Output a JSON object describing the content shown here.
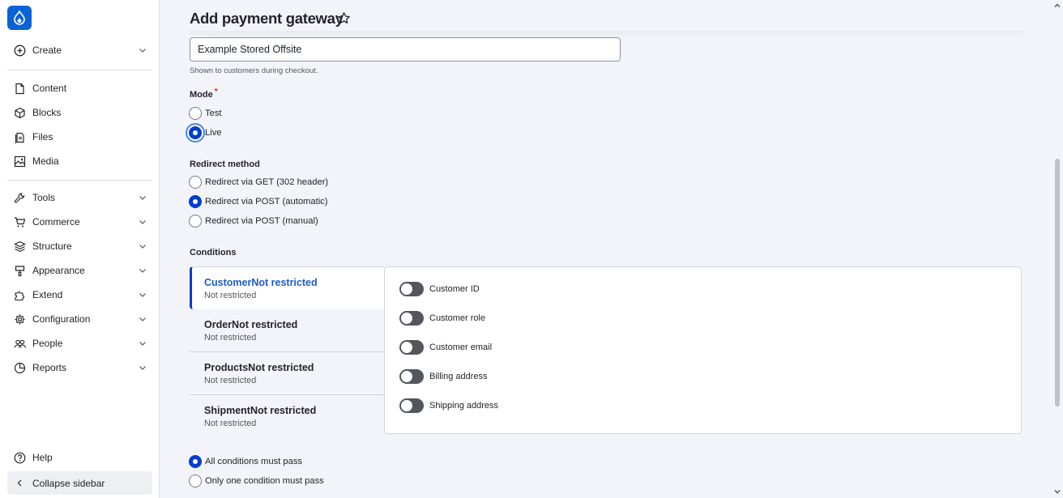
{
  "sidebar": {
    "logo": "drupal-drop-icon",
    "items": [
      {
        "label": "Create",
        "icon": "plus-circle-icon",
        "has_chevron": true
      },
      {
        "label": "Content",
        "icon": "document-icon",
        "has_chevron": false
      },
      {
        "label": "Blocks",
        "icon": "cube-icon",
        "has_chevron": false
      },
      {
        "label": "Files",
        "icon": "files-icon",
        "has_chevron": false
      },
      {
        "label": "Media",
        "icon": "image-icon",
        "has_chevron": false
      },
      {
        "label": "Tools",
        "icon": "wrench-icon",
        "has_chevron": true
      },
      {
        "label": "Commerce",
        "icon": "cart-icon",
        "has_chevron": true
      },
      {
        "label": "Structure",
        "icon": "layers-icon",
        "has_chevron": true
      },
      {
        "label": "Appearance",
        "icon": "paint-roller-icon",
        "has_chevron": true
      },
      {
        "label": "Extend",
        "icon": "puzzle-icon",
        "has_chevron": true
      },
      {
        "label": "Configuration",
        "icon": "gear-icon",
        "has_chevron": true
      },
      {
        "label": "People",
        "icon": "people-icon",
        "has_chevron": true
      },
      {
        "label": "Reports",
        "icon": "pie-chart-icon",
        "has_chevron": true
      }
    ],
    "help": "Help",
    "collapse": "Collapse sidebar"
  },
  "page": {
    "title": "Add payment gateway",
    "display_name": {
      "value": "Example Stored Offsite",
      "description": "Shown to customers during checkout."
    },
    "mode": {
      "label": "Mode",
      "required_mark": "*",
      "options": [
        "Test",
        "Live"
      ],
      "selected": "Live"
    },
    "redirect": {
      "label": "Redirect method",
      "options": [
        "Redirect via GET (302 header)",
        "Redirect via POST (automatic)",
        "Redirect via POST (manual)"
      ],
      "selected": "Redirect via POST (automatic)"
    },
    "conditions": {
      "label": "Conditions",
      "tabs": [
        {
          "title": "CustomerNot restricted",
          "summary": "Not restricted",
          "active": true
        },
        {
          "title": "OrderNot restricted",
          "summary": "Not restricted",
          "active": false
        },
        {
          "title": "ProductsNot restricted",
          "summary": "Not restricted",
          "active": false
        },
        {
          "title": "ShipmentNot restricted",
          "summary": "Not restricted",
          "active": false
        }
      ],
      "toggles": [
        {
          "label": "Customer ID",
          "on": false
        },
        {
          "label": "Customer role",
          "on": false
        },
        {
          "label": "Customer email",
          "on": false
        },
        {
          "label": "Billing address",
          "on": false
        },
        {
          "label": "Shipping address",
          "on": false
        }
      ],
      "operator_options": [
        "All conditions must pass",
        "Only one condition must pass"
      ],
      "operator_selected": "All conditions must pass"
    }
  },
  "colors": {
    "accent": "#003ecc",
    "active_tab_text": "#1d5cc8",
    "logo_bg": "#0a63d6",
    "required": "#dc2323"
  }
}
